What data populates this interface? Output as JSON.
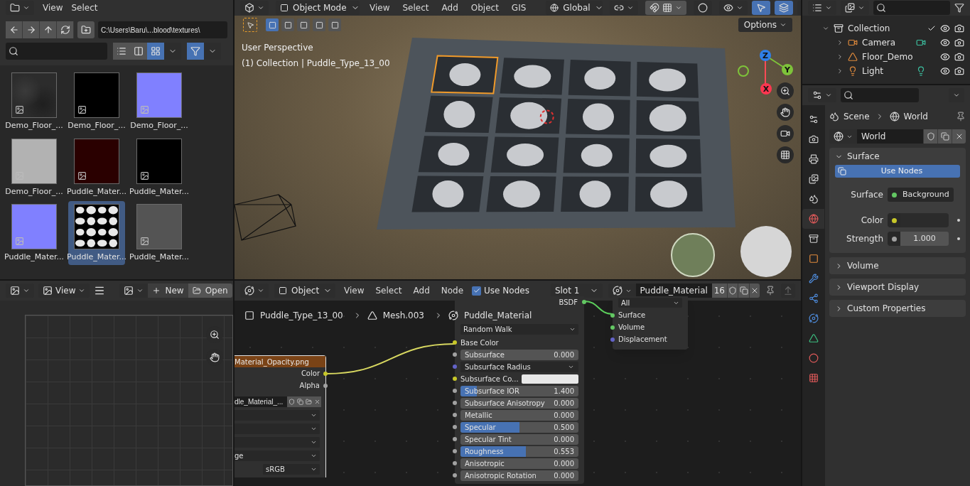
{
  "file_browser": {
    "menus": [
      "View",
      "Select"
    ],
    "path": "C:\\Users\\Baru\\...blood\\textures\\",
    "display_modes": [
      {
        "kind": "list",
        "selected": false
      },
      {
        "kind": "columns",
        "selected": false
      },
      {
        "kind": "thumbnails",
        "selected": true
      }
    ],
    "filter_on": true,
    "files": [
      {
        "name": "Demo_Floor_...",
        "kind": "noise",
        "color": "#2c2c2c",
        "selected": false
      },
      {
        "name": "Demo_Floor_...",
        "kind": "flat",
        "color": "#000000",
        "selected": false
      },
      {
        "name": "Demo_Floor_...",
        "kind": "flat",
        "color": "#8080ff",
        "selected": false
      },
      {
        "name": "Demo_Floor_...",
        "kind": "flat",
        "color": "#b2b2b2",
        "selected": false
      },
      {
        "name": "Puddle_Mater...",
        "kind": "flat",
        "color": "#2a0000",
        "selected": false
      },
      {
        "name": "Puddle_Mater...",
        "kind": "flat",
        "color": "#000000",
        "selected": false
      },
      {
        "name": "Puddle_Mater...",
        "kind": "flat",
        "color": "#8080ff",
        "selected": false
      },
      {
        "name": "Puddle_Mater...",
        "kind": "mask",
        "color": "#000000",
        "selected": true
      },
      {
        "name": "Puddle_Mater...",
        "kind": "flat",
        "color": "#545454",
        "selected": false
      }
    ]
  },
  "viewport": {
    "mode": "Object Mode",
    "menus": [
      "View",
      "Select",
      "Add",
      "Object",
      "GIS"
    ],
    "orientation": "Global",
    "options": "Options",
    "overlay_lines": [
      "User Perspective",
      "(1) Collection | Puddle_Type_13_00"
    ],
    "axes": {
      "x": "X",
      "y": "Y",
      "z": "Z"
    }
  },
  "outliner": {
    "items": [
      {
        "name": "Collection",
        "checked": true,
        "expanded": true,
        "children": [
          {
            "name": "Camera",
            "kind": "camera"
          },
          {
            "name": "Floor_Demo",
            "kind": "mesh"
          },
          {
            "name": "Light",
            "kind": "light"
          }
        ]
      }
    ]
  },
  "properties": {
    "tabs": [
      {
        "kind": "tool",
        "selected": false
      },
      {
        "kind": "render",
        "selected": false
      },
      {
        "kind": "output",
        "selected": false
      },
      {
        "kind": "view_layer",
        "selected": false
      },
      {
        "kind": "scene",
        "selected": false
      },
      {
        "kind": "world",
        "selected": true
      },
      {
        "kind": "collection",
        "selected": false
      },
      {
        "kind": "object",
        "selected": false
      },
      {
        "kind": "modifiers",
        "selected": false
      },
      {
        "kind": "particles",
        "selected": false
      },
      {
        "kind": "physics",
        "selected": false
      },
      {
        "kind": "data",
        "selected": false
      },
      {
        "kind": "material",
        "selected": false
      },
      {
        "kind": "texture",
        "selected": false
      }
    ],
    "breadcrumb": [
      "Scene",
      "World"
    ],
    "world_name": "World",
    "use_nodes": "Use Nodes",
    "fields": [
      {
        "label": "Surface",
        "kind": "link",
        "value": "Background",
        "color": "#63c763"
      },
      {
        "label": "Color",
        "kind": "color",
        "color": "#c7c729"
      },
      {
        "label": "Strength",
        "kind": "number",
        "value": "1.000",
        "color": "#a1a1a1"
      }
    ],
    "panels": [
      {
        "title": "Surface",
        "expanded": true
      },
      {
        "title": "Volume",
        "expanded": false
      },
      {
        "title": "Viewport Display",
        "expanded": false
      },
      {
        "title": "Custom Properties",
        "expanded": false
      }
    ]
  },
  "image_editor": {
    "view": "View",
    "new": "New",
    "open": "Open"
  },
  "node_editor": {
    "mode": "Object",
    "menus": [
      "View",
      "Select",
      "Add",
      "Node"
    ],
    "use_nodes": {
      "label": "Use Nodes",
      "checked": true
    },
    "slot": "Slot 1",
    "material": "Puddle_Material",
    "users": "16",
    "breadcrumb": [
      "Puddle_Type_13_00",
      "Mesh.003",
      "Puddle_Material"
    ],
    "image_node": {
      "title": "Material_Opacity.png",
      "outputs": [
        {
          "name": "Color",
          "color": "#c7c729"
        },
        {
          "name": "Alpha",
          "color": "#a1a1a1"
        }
      ],
      "image": "dle_Material_...",
      "dropdowns": [
        "ge",
        "sRGB"
      ]
    },
    "bsdf": {
      "output": "BSDF",
      "dropdowns": [
        "Random Walk"
      ],
      "inputs": [
        {
          "name": "Base Color",
          "kind": "socket",
          "color": "#c7c729"
        },
        {
          "name": "Subsurface",
          "kind": "slider",
          "value": "0.000",
          "level": 0,
          "color": "#a1a1a1"
        },
        {
          "name": "Subsurface Radius",
          "kind": "dropdown",
          "color": "#6363c7"
        },
        {
          "name": "Subsurface Co...",
          "kind": "swatch",
          "color": "#c7c729"
        },
        {
          "name": "Subsurface IOR",
          "kind": "slider",
          "value": "1.400",
          "level": 0.14,
          "color": "#a1a1a1"
        },
        {
          "name": "Subsurface Anisotropy",
          "kind": "slider",
          "value": "0.000",
          "level": 0,
          "color": "#a1a1a1"
        },
        {
          "name": "Metallic",
          "kind": "slider",
          "value": "0.000",
          "level": 0,
          "color": "#a1a1a1"
        },
        {
          "name": "Specular",
          "kind": "slider",
          "value": "0.500",
          "level": 0.5,
          "color": "#a1a1a1"
        },
        {
          "name": "Specular Tint",
          "kind": "slider",
          "value": "0.000",
          "level": 0,
          "color": "#a1a1a1"
        },
        {
          "name": "Roughness",
          "kind": "slider",
          "value": "0.553",
          "level": 0.553,
          "color": "#a1a1a1"
        },
        {
          "name": "Anisotropic",
          "kind": "slider",
          "value": "0.000",
          "level": 0,
          "color": "#a1a1a1"
        },
        {
          "name": "Anisotropic Rotation",
          "kind": "slider",
          "value": "0.000",
          "level": 0,
          "color": "#a1a1a1"
        }
      ]
    },
    "output_node": {
      "dropdown": "All",
      "inputs": [
        {
          "name": "Surface",
          "color": "#63c763"
        },
        {
          "name": "Volume",
          "color": "#63c763"
        },
        {
          "name": "Displacement",
          "color": "#6363c7"
        }
      ]
    }
  }
}
